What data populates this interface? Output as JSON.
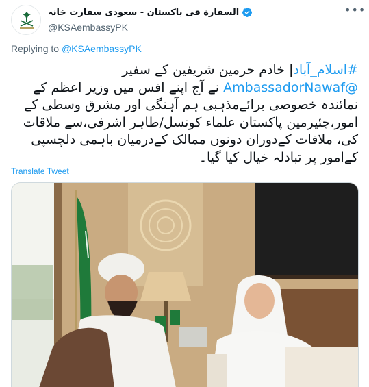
{
  "author": {
    "display_name": "السفارة فی باکستان - سعودی سفارت خانہ",
    "handle": "@KSAembassyPK",
    "verified": true
  },
  "reply": {
    "prefix": "Replying to ",
    "handle": "@KSAembassyPK"
  },
  "tweet": {
    "hashtag": "#اسلام_آباد",
    "text_1": "| خادم حرمین شریفین کے سفیر",
    "mention": "@AmbassadorNawaf",
    "text_2": " نے آج اپنے افس میں وزیر اعظم کے نمائندہ خصوصی برائےمذہبی ہم آہنگی اور مشرق وسطی کے امور،چئیرمین پاکستان علماء کونسل/طاہر اشرفی،سے ملاقات کی، ملاقات کےدوران دونوں ممالک کےدرمیان باہمی دلچسپی کےامور پر تبادلہ خیال کیا گیا۔"
  },
  "translate_label": "Translate Tweet",
  "icons": {
    "more": "more-horizontal-icon",
    "verified": "verified-badge-icon",
    "avatar": "saudi-emblem-icon"
  },
  "colors": {
    "link": "#1d9bf0",
    "text": "#0f1419",
    "muted": "#536471",
    "flag_green": "#1f7a3a"
  }
}
